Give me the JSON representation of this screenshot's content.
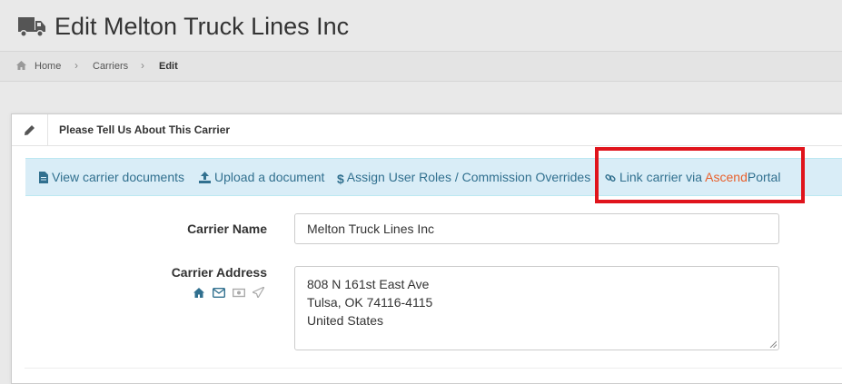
{
  "header": {
    "title": "Edit Melton Truck Lines Inc",
    "icon": "truck-icon"
  },
  "breadcrumb": {
    "items": [
      "Home",
      "Carriers",
      "Edit"
    ]
  },
  "card": {
    "title": "Please Tell Us About This Carrier",
    "icon": "pencil-icon"
  },
  "actions": {
    "view_documents": "View carrier documents",
    "upload_document": "Upload a document",
    "assign_roles": "Assign User Roles / Commission Overrides",
    "link_prefix": "Link carrier via ",
    "link_ascend": "Ascend",
    "link_portal": "Portal"
  },
  "form": {
    "carrier_name_label": "Carrier Name",
    "carrier_name_value": "Melton Truck Lines Inc",
    "carrier_address_label": "Carrier Address",
    "carrier_address_lines": [
      "808 N 161st East Ave",
      "Tulsa, OK 74116-4115",
      "United States"
    ],
    "address_icons": [
      "home-icon",
      "envelope-icon",
      "money-icon",
      "paper-plane-icon"
    ]
  },
  "colors": {
    "link": "#31708f",
    "ascend": "#e8602c",
    "highlight": "#e0141c",
    "info_bg": "#d9edf7"
  }
}
